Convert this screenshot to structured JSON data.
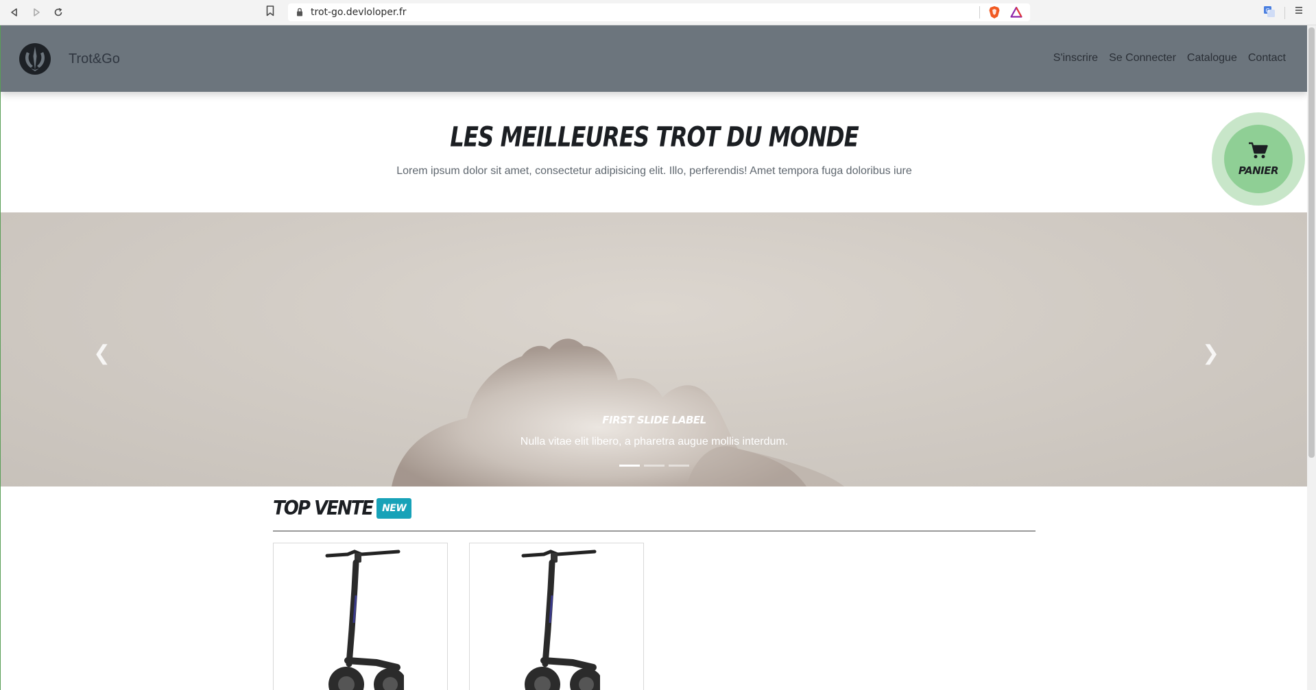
{
  "browser": {
    "url": "trot-go.devloloper.fr"
  },
  "navbar": {
    "brand": "Trot&Go",
    "links": [
      "S'inscrire",
      "Se Connecter",
      "Catalogue",
      "Contact"
    ]
  },
  "hero": {
    "title": "Les meilleures trot du monde",
    "subtitle": "Lorem ipsum dolor sit amet, consectetur adipisicing elit. Illo, perferendis! Amet tempora fuga doloribus iure"
  },
  "cart": {
    "label": "Panier"
  },
  "carousel": {
    "caption_title": "First slide label",
    "caption_text": "Nulla vitae elit libero, a pharetra augue mollis interdum.",
    "slide_count": 3,
    "active_index": 0
  },
  "top_sales": {
    "title": "Top vente",
    "badge": "New"
  },
  "colors": {
    "navbar": "#6c757d",
    "badge": "#17a2b8",
    "cart": "#8fcf95"
  }
}
